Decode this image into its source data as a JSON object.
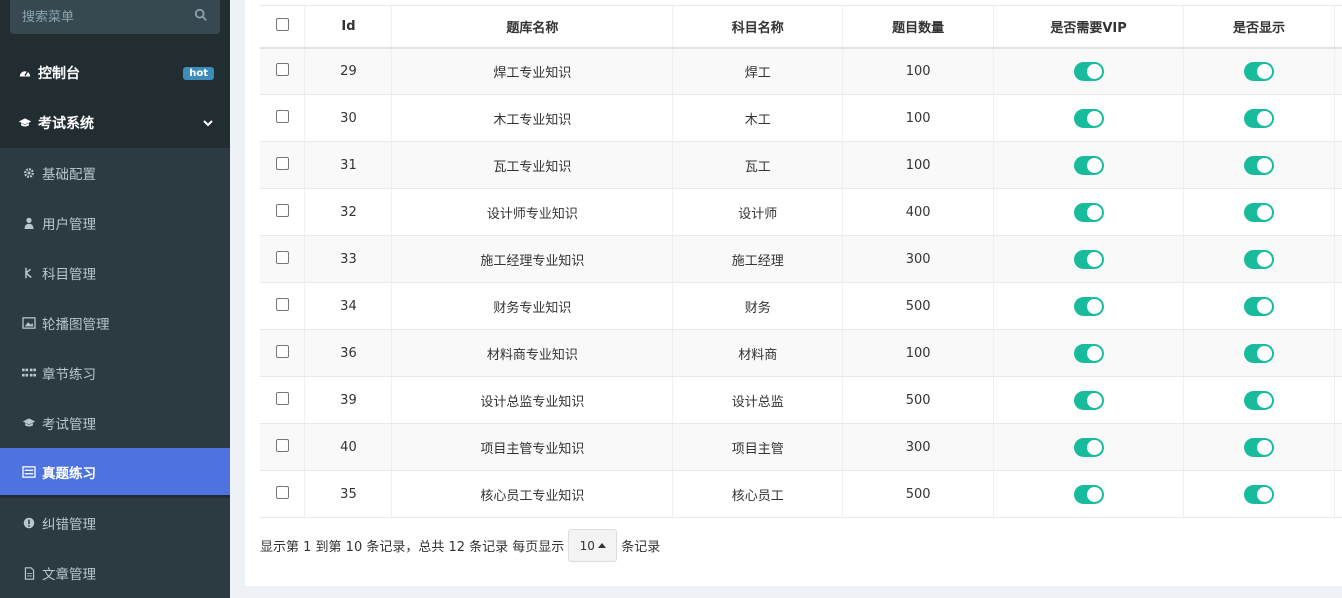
{
  "sidebar": {
    "search_placeholder": "搜索菜单",
    "dashboard": {
      "label": "控制台",
      "badge": "hot"
    },
    "exam_system": {
      "label": "考试系统"
    },
    "items": [
      {
        "label": "基础配置",
        "icon": "gear-icon"
      },
      {
        "label": "用户管理",
        "icon": "user-icon"
      },
      {
        "label": "科目管理",
        "icon": "subject-icon"
      },
      {
        "label": "轮播图管理",
        "icon": "image-icon"
      },
      {
        "label": "章节练习",
        "icon": "grid-icon"
      },
      {
        "label": "考试管理",
        "icon": "graduation-cap-icon"
      },
      {
        "label": "真题练习",
        "icon": "list-icon",
        "active": true
      },
      {
        "label": "纠错管理",
        "icon": "exclamation-icon"
      },
      {
        "label": "文章管理",
        "icon": "document-icon"
      }
    ]
  },
  "table": {
    "headers": [
      "Id",
      "题库名称",
      "科目名称",
      "题目数量",
      "是否需要VIP",
      "是否显示"
    ],
    "rows": [
      {
        "id": "29",
        "name": "焊工专业知识",
        "subject": "焊工",
        "count": "100"
      },
      {
        "id": "30",
        "name": "木工专业知识",
        "subject": "木工",
        "count": "100"
      },
      {
        "id": "31",
        "name": "瓦工专业知识",
        "subject": "瓦工",
        "count": "100"
      },
      {
        "id": "32",
        "name": "设计师专业知识",
        "subject": "设计师",
        "count": "400"
      },
      {
        "id": "33",
        "name": "施工经理专业知识",
        "subject": "施工经理",
        "count": "300"
      },
      {
        "id": "34",
        "name": "财务专业知识",
        "subject": "财务",
        "count": "500"
      },
      {
        "id": "36",
        "name": "材料商专业知识",
        "subject": "材料商",
        "count": "100"
      },
      {
        "id": "39",
        "name": "设计总监专业知识",
        "subject": "设计总监",
        "count": "500"
      },
      {
        "id": "40",
        "name": "项目主管专业知识",
        "subject": "项目主管",
        "count": "300"
      },
      {
        "id": "35",
        "name": "核心员工专业知识",
        "subject": "核心员工",
        "count": "500"
      }
    ]
  },
  "footer": {
    "summary": "显示第 1 到第 10 条记录，总共 12 条记录 每页显示",
    "page_size": "10",
    "suffix": "条记录"
  },
  "colors": {
    "toggle_on": "#18bc9c",
    "active_menu": "#4e73df",
    "sidebar_bg": "#222d32"
  }
}
